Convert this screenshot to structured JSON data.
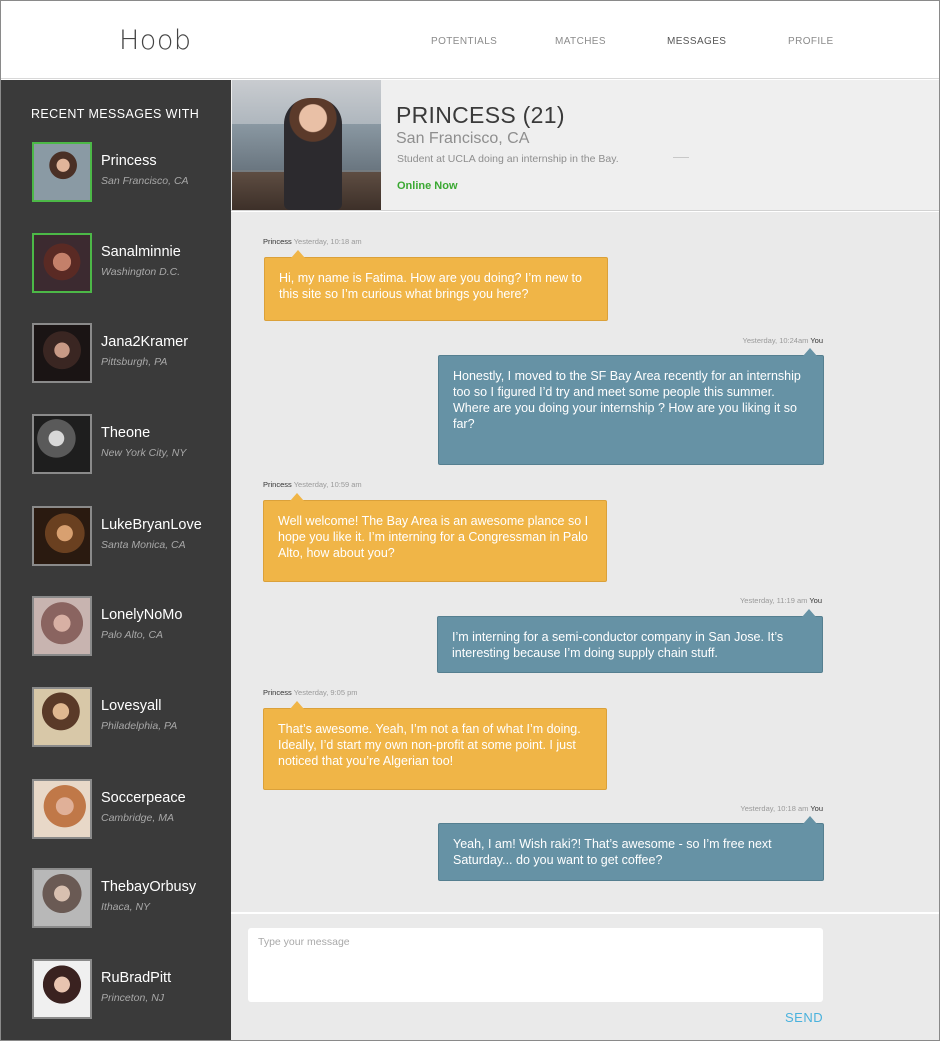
{
  "app": {
    "name": "Hoob"
  },
  "nav": {
    "potentials": "POTENTIALS",
    "matches": "MATCHES",
    "messages": "MESSAGES",
    "profile": "PROFILE",
    "active": "messages"
  },
  "sidebar": {
    "title": "RECENT MESSAGES WITH",
    "contacts": [
      {
        "name": "Princess",
        "location": "San Francisco, CA",
        "online": true
      },
      {
        "name": "Sanalminnie",
        "location": "Washington D.C.",
        "online": true
      },
      {
        "name": "Jana2Kramer",
        "location": "Pittsburgh, PA",
        "online": false
      },
      {
        "name": "Theone",
        "location": "New York City, NY",
        "online": false
      },
      {
        "name": "LukeBryanLove",
        "location": "Santa Monica, CA",
        "online": false
      },
      {
        "name": "LonelyNoMo",
        "location": "Palo Alto, CA",
        "online": false
      },
      {
        "name": "Lovesyall",
        "location": "Philadelphia, PA",
        "online": false
      },
      {
        "name": "Soccerpeace",
        "location": "Cambridge, MA",
        "online": false
      },
      {
        "name": "ThebayOrbusy",
        "location": "Ithaca, NY",
        "online": false
      },
      {
        "name": "RuBradPitt",
        "location": "Princeton, NJ",
        "online": false
      }
    ]
  },
  "profile": {
    "name": "PRINCESS (21)",
    "location": "San Francisco, CA",
    "bio": "Student at UCLA doing an internship in the Bay.",
    "status": "Online Now"
  },
  "messages": [
    {
      "sender": "Princess",
      "time": "Yesterday, 10:18 am",
      "from_me": false,
      "text": "Hi, my name is Fatima. How are you doing? I’m new to this site so I’m curious what brings you here?"
    },
    {
      "sender": "You",
      "time": "Yesterday, 10:24am",
      "from_me": true,
      "text": "Honestly, I moved to the SF Bay Area recently for an internship too so I figured I’d try and meet some people this summer. Where are you doing your internship ? How are you liking it so far?"
    },
    {
      "sender": "Princess",
      "time": "Yesterday, 10:59 am",
      "from_me": false,
      "text": "Well welcome! The Bay Area is an awesome plance so I hope you like it. I’m interning for a Congressman in Palo Alto, how about you?"
    },
    {
      "sender": "You",
      "time": "Yesterday, 11:19 am",
      "from_me": true,
      "text": "I’m interning for a semi-conductor company in San Jose. It’s interesting because I’m doing supply chain stuff."
    },
    {
      "sender": "Princess",
      "time": "Yesterday, 9:05 pm",
      "from_me": false,
      "text": "That’s awesome. Yeah, I’m not a fan of what I’m doing. Ideally, I’d start my own non-profit at some point. I just noticed that  you’re Algerian too!"
    },
    {
      "sender": "You",
      "time": "Yesterday, 10:18 am",
      "from_me": true,
      "text": "Yeah, I am! Wish raki?! That’s awesome - so I’m free next Saturday... do you want to get coffee?"
    }
  ],
  "composer": {
    "placeholder": "Type your message",
    "value": "",
    "send_label": "SEND"
  },
  "colors": {
    "their_bubble": "#f0b547",
    "my_bubble": "#6692a5",
    "sidebar_bg": "#3a3a3a",
    "online_green": "#4cb847",
    "send_blue": "#4ab2dd"
  }
}
